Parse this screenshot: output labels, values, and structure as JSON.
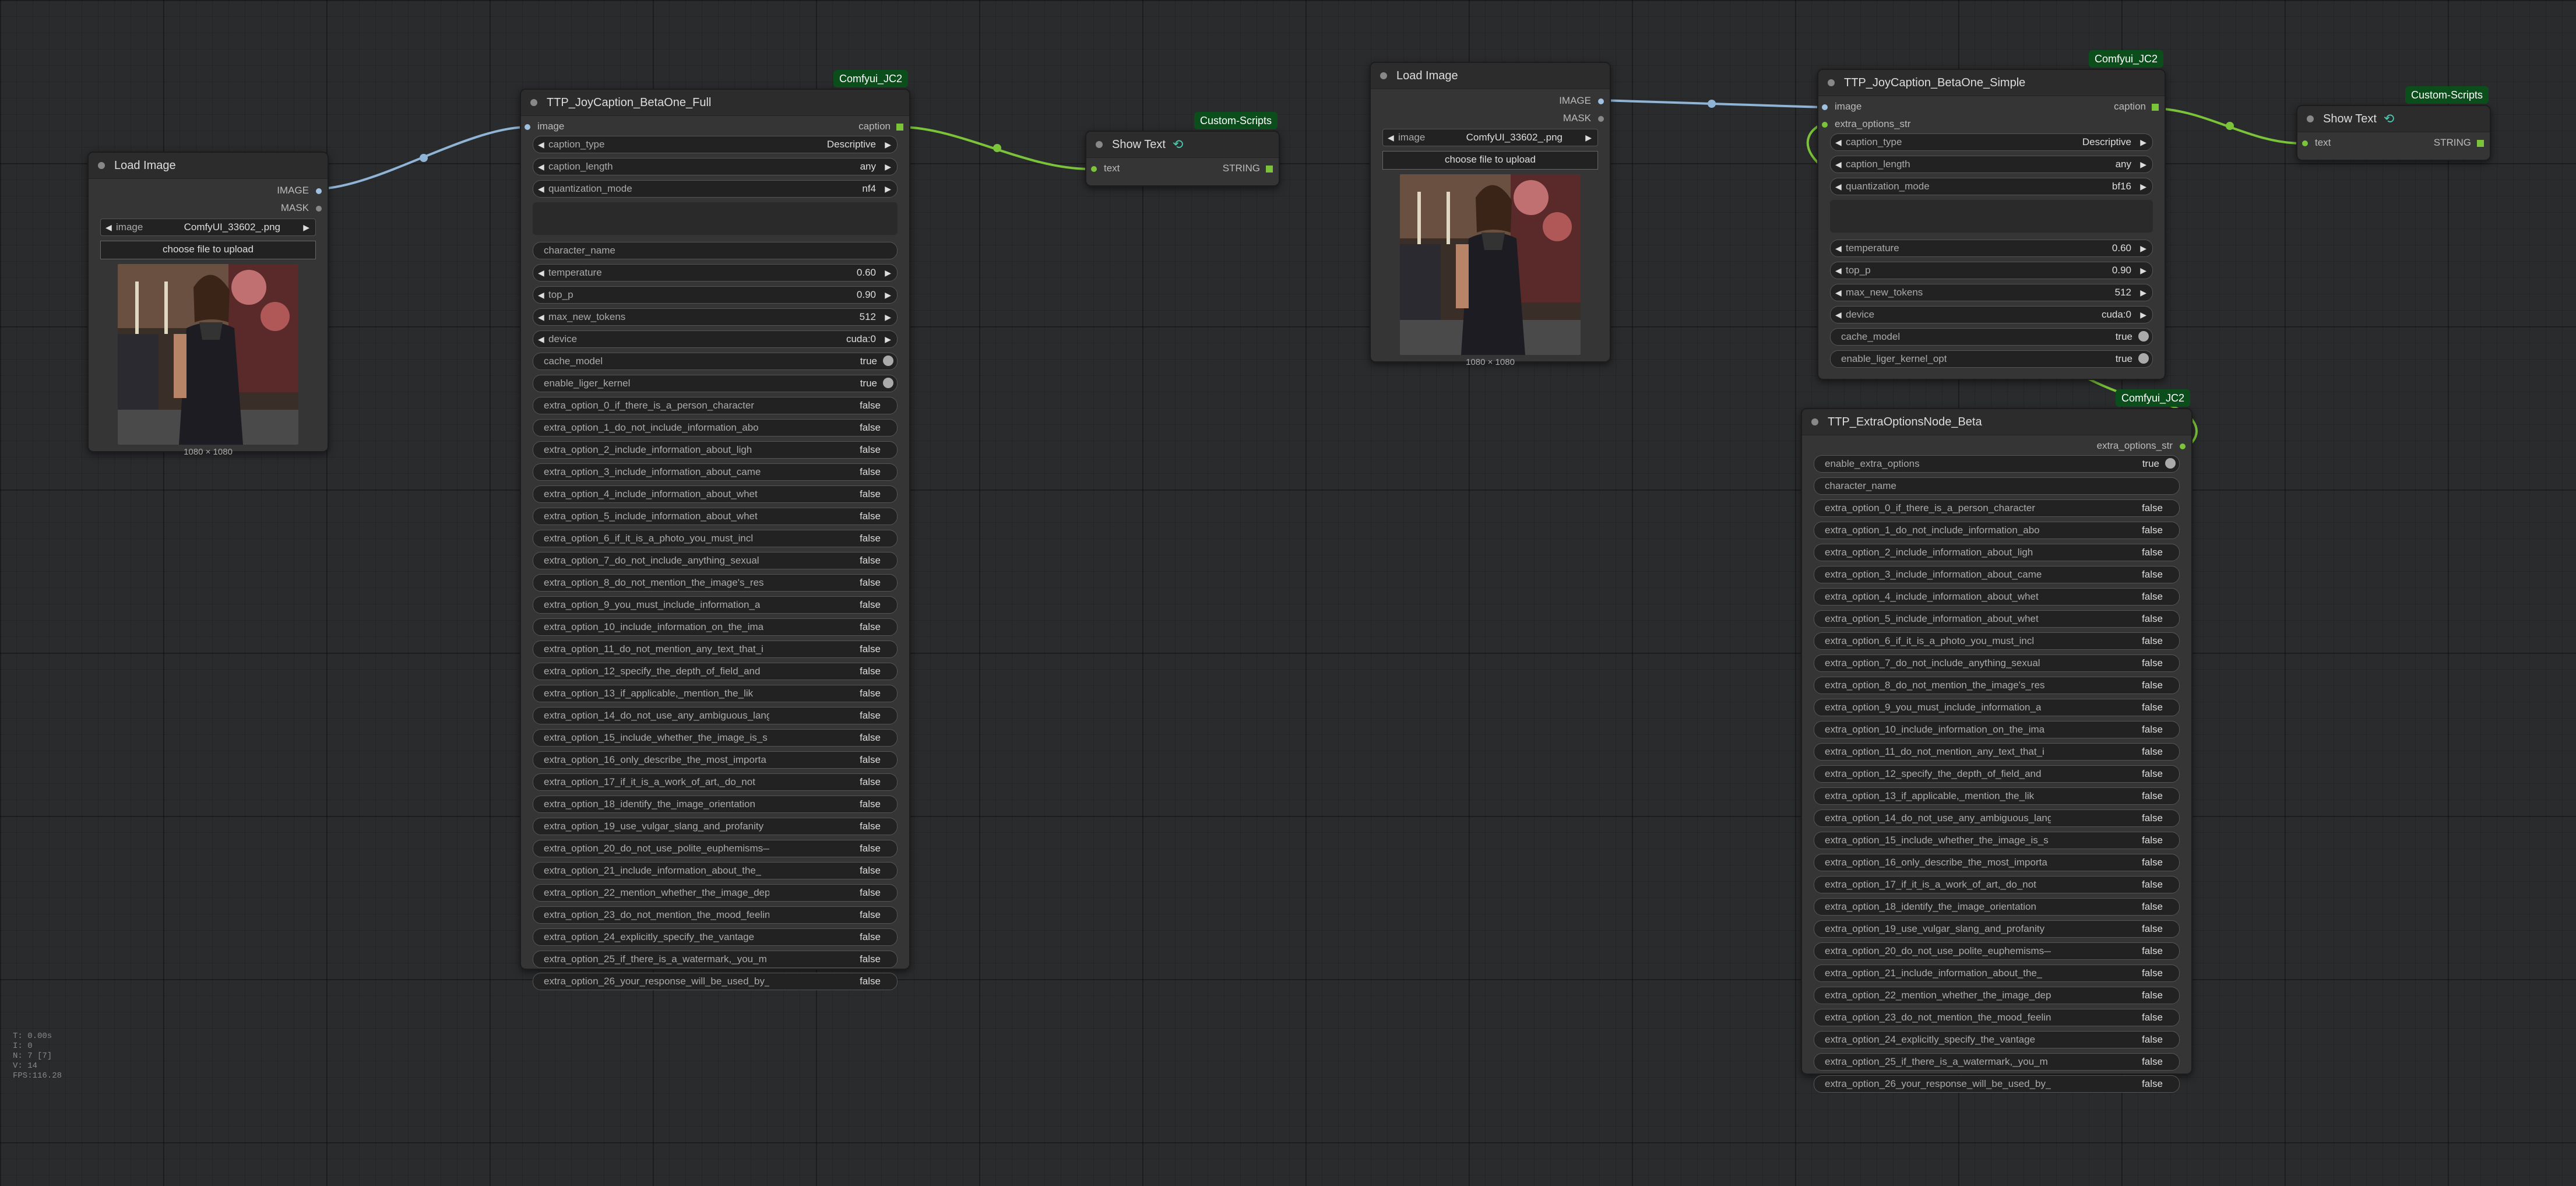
{
  "colors": {
    "canvas": "#2a2b2d",
    "node_bg": "#353535",
    "title_bg": "#2c2c2c",
    "image_link": "#8fb4d6",
    "string_link": "#7bc43a",
    "badge": "#0c4d1c"
  },
  "stats": [
    "T: 0.00s",
    "I: 0",
    "N: 7 [7]",
    "V: 14",
    "FPS:116.28"
  ],
  "load_image_1": {
    "title": "Load Image",
    "outputs": [
      "IMAGE",
      "MASK"
    ],
    "image_label": "image",
    "image_value": "ComfyUI_33602_.png",
    "upload_label": "choose file to upload",
    "caption": "1080 × 1080"
  },
  "joycaption_full": {
    "title": "TTP_JoyCaption_BetaOne_Full",
    "badge": "Comfyui_JC2",
    "input": "image",
    "output": "caption",
    "combos": [
      {
        "label": "caption_type",
        "value": "Descriptive"
      },
      {
        "label": "caption_length",
        "value": "any"
      },
      {
        "label": "quantization_mode",
        "value": "nf4"
      }
    ],
    "character_name": "character_name",
    "numbers": [
      {
        "label": "temperature",
        "value": "0.60"
      },
      {
        "label": "top_p",
        "value": "0.90"
      },
      {
        "label": "max_new_tokens",
        "value": "512"
      },
      {
        "label": "device",
        "value": "cuda:0"
      }
    ],
    "toggles": [
      {
        "label": "cache_model",
        "value": "true"
      },
      {
        "label": "enable_liger_kernel",
        "value": "true"
      }
    ],
    "options": [
      {
        "label": "extra_option_0_if_there_is_a_person_character",
        "value": "false"
      },
      {
        "label": "extra_option_1_do_not_include_information_abo",
        "value": "false"
      },
      {
        "label": "extra_option_2_include_information_about_ligh",
        "value": "false"
      },
      {
        "label": "extra_option_3_include_information_about_came",
        "value": "false"
      },
      {
        "label": "extra_option_4_include_information_about_whet",
        "value": "false"
      },
      {
        "label": "extra_option_5_include_information_about_whet",
        "value": "false"
      },
      {
        "label": "extra_option_6_if_it_is_a_photo_you_must_incl",
        "value": "false"
      },
      {
        "label": "extra_option_7_do_not_include_anything_sexual",
        "value": "false"
      },
      {
        "label": "extra_option_8_do_not_mention_the_image's_res",
        "value": "false"
      },
      {
        "label": "extra_option_9_you_must_include_information_a",
        "value": "false"
      },
      {
        "label": "extra_option_10_include_information_on_the_ima",
        "value": "false"
      },
      {
        "label": "extra_option_11_do_not_mention_any_text_that_i",
        "value": "false"
      },
      {
        "label": "extra_option_12_specify_the_depth_of_field_and",
        "value": "false"
      },
      {
        "label": "extra_option_13_if_applicable,_mention_the_lik",
        "value": "false"
      },
      {
        "label": "extra_option_14_do_not_use_any_ambiguous_langu",
        "value": "false"
      },
      {
        "label": "extra_option_15_include_whether_the_image_is_s",
        "value": "false"
      },
      {
        "label": "extra_option_16_only_describe_the_most_importa",
        "value": "false"
      },
      {
        "label": "extra_option_17_if_it_is_a_work_of_art,_do_not",
        "value": "false"
      },
      {
        "label": "extra_option_18_identify_the_image_orientation",
        "value": "false"
      },
      {
        "label": "extra_option_19_use_vulgar_slang_and_profanity",
        "value": "false"
      },
      {
        "label": "extra_option_20_do_not_use_polite_euphemisms—l",
        "value": "false"
      },
      {
        "label": "extra_option_21_include_information_about_the_",
        "value": "false"
      },
      {
        "label": "extra_option_22_mention_whether_the_image_depi",
        "value": "false"
      },
      {
        "label": "extra_option_23_do_not_mention_the_mood_feelin",
        "value": "false"
      },
      {
        "label": "extra_option_24_explicitly_specify_the_vantage",
        "value": "false"
      },
      {
        "label": "extra_option_25_if_there_is_a_watermark,_you_m",
        "value": "false"
      },
      {
        "label": "extra_option_26_your_response_will_be_used_by_",
        "value": "false"
      }
    ]
  },
  "show_text_1": {
    "title": "Show Text",
    "badge": "Custom-Scripts",
    "input": "text",
    "output": "STRING"
  },
  "load_image_2": {
    "title": "Load Image",
    "outputs": [
      "IMAGE",
      "MASK"
    ],
    "image_label": "image",
    "image_value": "ComfyUI_33602_.png",
    "upload_label": "choose file to upload",
    "caption": "1080 × 1080"
  },
  "joycaption_simple": {
    "title": "TTP_JoyCaption_BetaOne_Simple",
    "badge": "Comfyui_JC2",
    "inputs": [
      "image",
      "extra_options_str"
    ],
    "output": "caption",
    "combos": [
      {
        "label": "caption_type",
        "value": "Descriptive"
      },
      {
        "label": "caption_length",
        "value": "any"
      },
      {
        "label": "quantization_mode",
        "value": "bf16"
      }
    ],
    "numbers": [
      {
        "label": "temperature",
        "value": "0.60"
      },
      {
        "label": "top_p",
        "value": "0.90"
      },
      {
        "label": "max_new_tokens",
        "value": "512"
      },
      {
        "label": "device",
        "value": "cuda:0"
      }
    ],
    "toggles": [
      {
        "label": "cache_model",
        "value": "true"
      },
      {
        "label": "enable_liger_kernel_opt",
        "value": "true"
      }
    ]
  },
  "show_text_2": {
    "title": "Show Text",
    "badge": "Custom-Scripts",
    "input": "text",
    "output": "STRING"
  },
  "extra_options": {
    "title": "TTP_ExtraOptionsNode_Beta",
    "badge": "Comfyui_JC2",
    "output": "extra_options_str",
    "enable": {
      "label": "enable_extra_options",
      "value": "true"
    },
    "character_name": "character_name"
  }
}
